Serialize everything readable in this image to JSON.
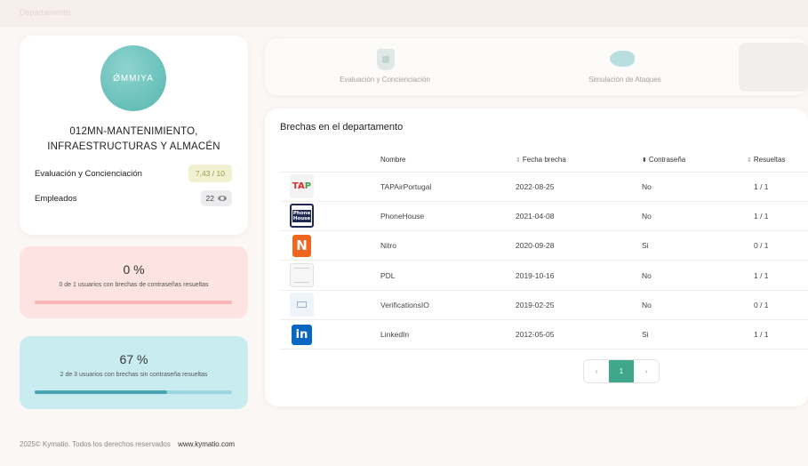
{
  "topbar": {
    "breadcrumb": "Departamento"
  },
  "profile": {
    "logo_text": "ǾMMIYA",
    "department": "012MN-MANTENIMIENTO, INFRAESTRUCTURAS Y ALMACÉN",
    "evaluation_label": "Evaluación y Concienciación",
    "evaluation_score": "7,43 / 10",
    "employees_label": "Empleados",
    "employees_count": "22"
  },
  "stats": {
    "unresolved": {
      "percent": "0 %",
      "desc": "0 de 1 usuarios con brechas de contraseñas resueltas",
      "fill": 0
    },
    "resolved": {
      "percent": "67 %",
      "desc": "2 de 3 usuarios con brechas sin contraseña resueltas",
      "fill": 0.67
    }
  },
  "tabs": [
    {
      "label": "Evaluación y Concienciación",
      "icon": "shield-lock-icon"
    },
    {
      "label": "Simulación de Ataques",
      "icon": "fish-icon"
    }
  ],
  "breaches": {
    "title": "Brechas en el departamento",
    "columns": {
      "name": "Nombre",
      "date": "Fecha brecha",
      "password": "Contraseña",
      "resolved": "Resueltas"
    },
    "rows": [
      {
        "logo": "TAP",
        "name": "TAPAirPortugal",
        "date": "2022-08-25",
        "password": "No",
        "resolved": "1 / 1"
      },
      {
        "logo": "PhoneHouse",
        "name": "PhoneHouse",
        "date": "2021-04-08",
        "password": "No",
        "resolved": "1 / 1"
      },
      {
        "logo": "Nitro",
        "name": "Nitro",
        "date": "2020-09-28",
        "password": "Si",
        "resolved": "0 / 1"
      },
      {
        "logo": "PDL",
        "name": "PDL",
        "date": "2019-10-16",
        "password": "No",
        "resolved": "1 / 1"
      },
      {
        "logo": "VerificationsIO",
        "name": "VerificationsIO",
        "date": "2019-02-25",
        "password": "No",
        "resolved": "0 / 1"
      },
      {
        "logo": "LinkedIn",
        "name": "LinkedIn",
        "date": "2012-05-05",
        "password": "Si",
        "resolved": "1 / 1"
      }
    ],
    "pagination": {
      "prev": "‹",
      "current": "1",
      "next": "›"
    }
  },
  "footer": {
    "copyright": "2025© Kymatio. Todos los derechos reservados",
    "link": "www.kymatio.com"
  }
}
